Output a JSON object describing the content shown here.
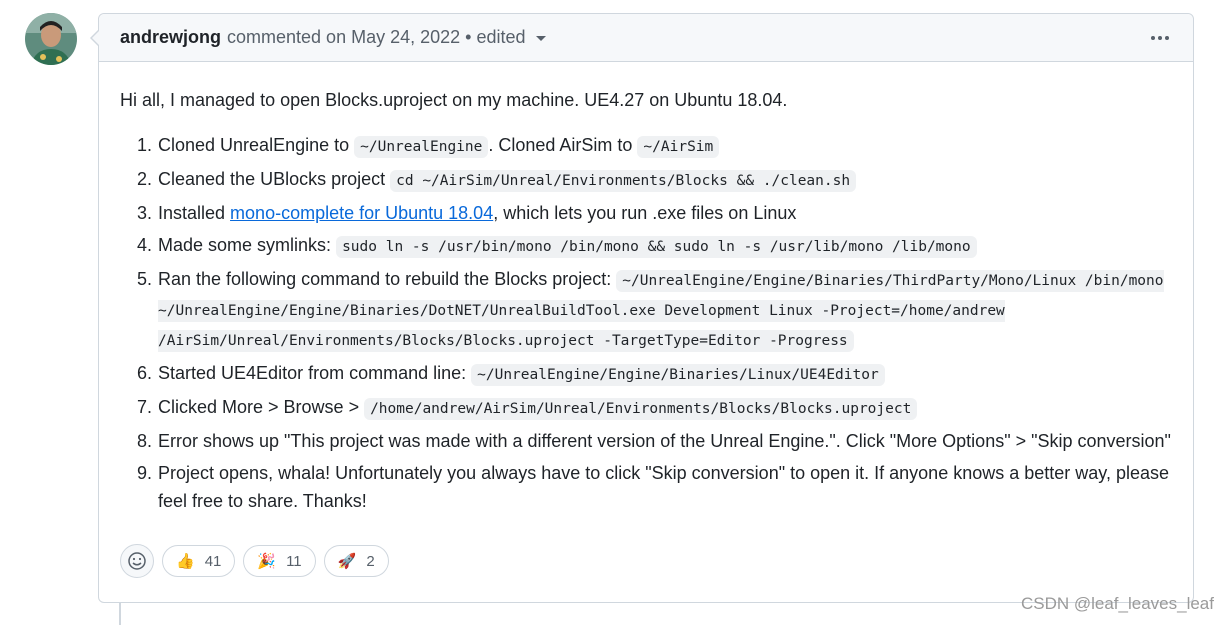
{
  "comment": {
    "author": "andrewjong",
    "meta_text": "commented on May 24, 2022",
    "separator": "•",
    "edited_label": "edited",
    "intro": "Hi all, I managed to open Blocks.uproject on my machine. UE4.27 on Ubuntu 18.04.",
    "steps": [
      {
        "t1": "Cloned UnrealEngine to ",
        "c1": "~/UnrealEngine",
        "t2": ". Cloned AirSim to ",
        "c2": "~/AirSim"
      },
      {
        "t1": "Cleaned the UBlocks project ",
        "c1": "cd ~/AirSim/Unreal/Environments/Blocks && ./clean.sh"
      },
      {
        "t1": "Installed ",
        "link": "mono-complete for Ubuntu 18.04",
        "t2": ", which lets you run .exe files on Linux"
      },
      {
        "t1": "Made some symlinks: ",
        "c1": "sudo ln -s /usr/bin/mono /bin/mono && sudo ln -s /usr/lib/mono /lib/mono"
      },
      {
        "t1": "Ran the following command to rebuild the Blocks project: ",
        "c1": "~/UnrealEngine/Engine/Binaries/ThirdParty/Mono/Linux /bin/mono ~/UnrealEngine/Engine/Binaries/DotNET/UnrealBuildTool.exe Development Linux -Project=/home/andrew /AirSim/Unreal/Environments/Blocks/Blocks.uproject -TargetType=Editor -Progress"
      },
      {
        "t1": "Started UE4Editor from command line: ",
        "c1": "~/UnrealEngine/Engine/Binaries/Linux/UE4Editor"
      },
      {
        "t1": "Clicked More > Browse > ",
        "c1": "/home/andrew/AirSim/Unreal/Environments/Blocks/Blocks.uproject"
      },
      {
        "t1": "Error shows up \"This project was made with a different version of the Unreal Engine.\". Click \"More Options\" > \"Skip conversion\""
      },
      {
        "t1": "Project opens, whala! Unfortunately you always have to click \"Skip conversion\" to open it. If anyone knows a better way, please feel free to share. Thanks!"
      }
    ],
    "reactions": [
      {
        "icon": "thumbs-up-icon",
        "emoji": "👍",
        "count": "41"
      },
      {
        "icon": "party-popper-icon",
        "emoji": "🎉",
        "count": "11"
      },
      {
        "icon": "rocket-icon",
        "emoji": "🚀",
        "count": "2"
      }
    ]
  },
  "watermark": "CSDN @leaf_leaves_leaf",
  "colors": {
    "link": "#0969da",
    "border": "#d0d7de",
    "header_bg": "#f6f8fa"
  }
}
